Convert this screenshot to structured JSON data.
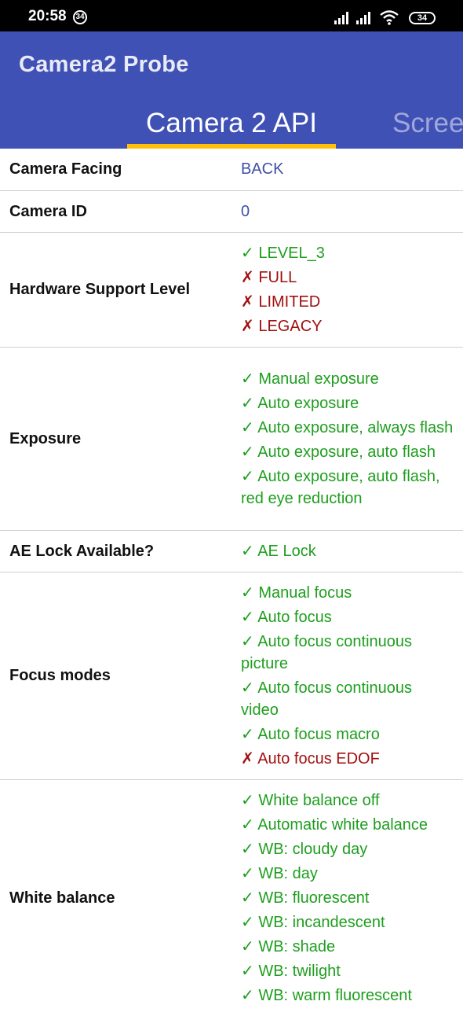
{
  "status_bar": {
    "time": "20:58",
    "notification_count": "34",
    "battery": "34"
  },
  "app": {
    "title": "Camera2 Probe"
  },
  "tabs": {
    "active": "Camera 2 API",
    "next": "Scree"
  },
  "rows": [
    {
      "label": "Camera Facing",
      "value": "BACK"
    },
    {
      "label": "Camera ID",
      "value": "0"
    },
    {
      "label": "Hardware Support Level",
      "items": [
        {
          "mark": "✓",
          "text": "LEVEL_3",
          "ok": true
        },
        {
          "mark": "✗",
          "text": "FULL",
          "ok": false
        },
        {
          "mark": "✗",
          "text": "LIMITED",
          "ok": false
        },
        {
          "mark": "✗",
          "text": "LEGACY",
          "ok": false
        }
      ]
    },
    {
      "label": "Exposure",
      "items": [
        {
          "mark": "✓",
          "text": "Manual exposure",
          "ok": true
        },
        {
          "mark": "✓",
          "text": "Auto exposure",
          "ok": true
        },
        {
          "mark": "✓",
          "text": "Auto exposure, always flash",
          "ok": true
        },
        {
          "mark": "✓",
          "text": "Auto exposure, auto flash",
          "ok": true
        },
        {
          "mark": "✓",
          "text": "Auto exposure, auto flash, red eye reduction",
          "ok": true
        }
      ]
    },
    {
      "label": "AE Lock Available?",
      "items": [
        {
          "mark": "✓",
          "text": "AE Lock",
          "ok": true
        }
      ]
    },
    {
      "label": "Focus modes",
      "items": [
        {
          "mark": "✓",
          "text": "Manual focus",
          "ok": true
        },
        {
          "mark": "✓",
          "text": "Auto focus",
          "ok": true
        },
        {
          "mark": "✓",
          "text": "Auto focus continuous picture",
          "ok": true
        },
        {
          "mark": "✓",
          "text": "Auto focus continuous video",
          "ok": true
        },
        {
          "mark": "✓",
          "text": "Auto focus macro",
          "ok": true
        },
        {
          "mark": "✗",
          "text": "Auto focus EDOF",
          "ok": false
        }
      ]
    },
    {
      "label": "White balance",
      "items": [
        {
          "mark": "✓",
          "text": "White balance off",
          "ok": true
        },
        {
          "mark": "✓",
          "text": "Automatic white balance",
          "ok": true
        },
        {
          "mark": "✓",
          "text": "WB: cloudy day",
          "ok": true
        },
        {
          "mark": "✓",
          "text": "WB: day",
          "ok": true
        },
        {
          "mark": "✓",
          "text": "WB: fluorescent",
          "ok": true
        },
        {
          "mark": "✓",
          "text": "WB: incandescent",
          "ok": true
        },
        {
          "mark": "✓",
          "text": "WB: shade",
          "ok": true
        },
        {
          "mark": "✓",
          "text": "WB: twilight",
          "ok": true
        },
        {
          "mark": "✓",
          "text": "WB: warm fluorescent",
          "ok": true
        }
      ]
    }
  ],
  "colors": {
    "app_bar": "#3f51b5",
    "tab_indicator": "#ffc107",
    "supported": "#1e9e1e",
    "unsupported": "#a01010",
    "plain_value": "#3f4fa8"
  }
}
